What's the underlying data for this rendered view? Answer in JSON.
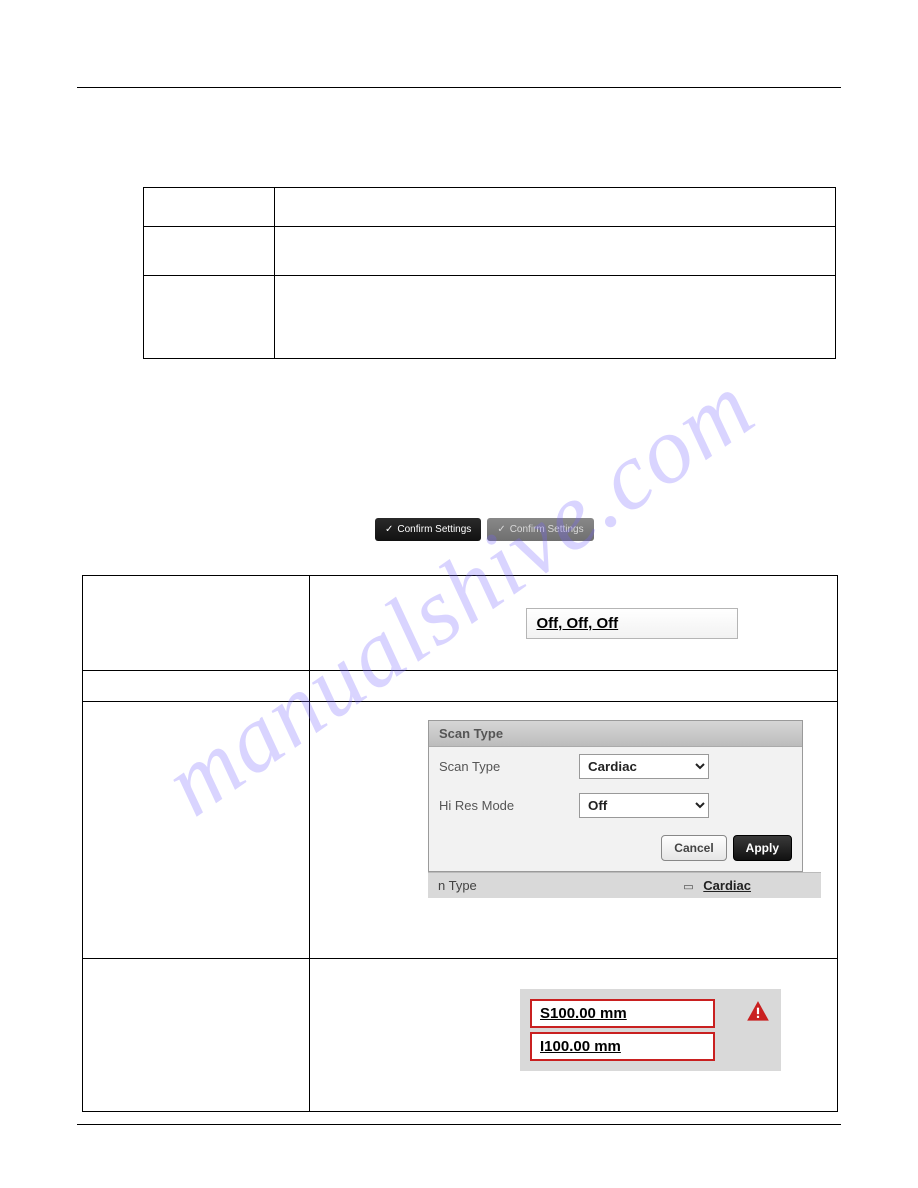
{
  "watermark": "manualshive.com",
  "buttons": {
    "confirm_active": "Confirm Settings",
    "confirm_inactive": "Confirm Settings"
  },
  "field_off": "Off, Off, Off",
  "dialog": {
    "title": "Scan Type",
    "row1_label": "Scan Type",
    "row1_value": "Cardiac",
    "row2_label": "Hi Res Mode",
    "row2_value": "Off",
    "cancel": "Cancel",
    "apply": "Apply",
    "strip_label": "n Type",
    "strip_value": "Cardiac"
  },
  "red": {
    "v1": "S100.00 mm",
    "v2": "I100.00 mm"
  }
}
